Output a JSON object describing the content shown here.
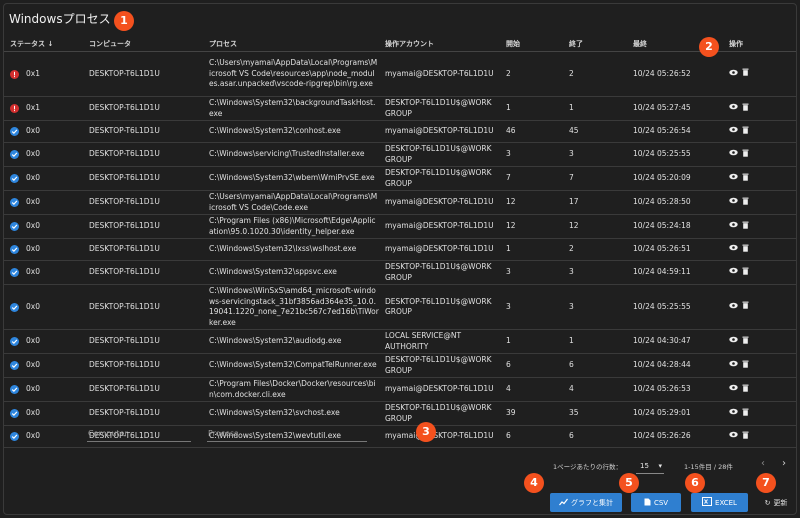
{
  "title": "Windowsプロセス",
  "columns": {
    "status": "ステータス",
    "computer": "コンピュータ",
    "process": "プロセス",
    "account": "操作アカウント",
    "start": "開始",
    "end": "終了",
    "latest": "最終",
    "ops": "操作"
  },
  "rows": [
    {
      "status": "err",
      "code": "0x1",
      "computer": "DESKTOP-T6L1D1U",
      "process": "C:\\Users\\myamai\\AppData\\Local\\Programs\\Microsoft VS Code\\resources\\app\\node_modules.asar.unpacked\\vscode-ripgrep\\bin\\rg.exe",
      "account": "myamai@DESKTOP-T6L1D1U",
      "start": "2",
      "end": "2",
      "latest": "10/24 05:26:52",
      "h": "h4"
    },
    {
      "status": "err",
      "code": "0x1",
      "computer": "DESKTOP-T6L1D1U",
      "process": "C:\\Windows\\System32\\backgroundTaskHost.exe",
      "account": "DESKTOP-T6L1D1U$@WORK GROUP",
      "start": "1",
      "end": "1",
      "latest": "10/24 05:27:45",
      "h": "h2"
    },
    {
      "status": "ok",
      "code": "0x0",
      "computer": "DESKTOP-T6L1D1U",
      "process": "C:\\Windows\\System32\\conhost.exe",
      "account": "myamai@DESKTOP-T6L1D1U",
      "start": "46",
      "end": "45",
      "latest": "10/24 05:26:54",
      "h": "r"
    },
    {
      "status": "ok",
      "code": "0x0",
      "computer": "DESKTOP-T6L1D1U",
      "process": "C:\\Windows\\servicing\\TrustedInstaller.exe",
      "account": "DESKTOP-T6L1D1U$@WORK GROUP",
      "start": "3",
      "end": "3",
      "latest": "10/24 05:25:55",
      "h": "h2"
    },
    {
      "status": "ok",
      "code": "0x0",
      "computer": "DESKTOP-T6L1D1U",
      "process": "C:\\Windows\\System32\\wbem\\WmiPrvSE.exe",
      "account": "DESKTOP-T6L1D1U$@WORK GROUP",
      "start": "7",
      "end": "7",
      "latest": "10/24 05:20:09",
      "h": "h2"
    },
    {
      "status": "ok",
      "code": "0x0",
      "computer": "DESKTOP-T6L1D1U",
      "process": "C:\\Users\\myamai\\AppData\\Local\\Programs\\Microsoft VS Code\\Code.exe",
      "account": "myamai@DESKTOP-T6L1D1U",
      "start": "12",
      "end": "17",
      "latest": "10/24 05:28:50",
      "h": "h2"
    },
    {
      "status": "ok",
      "code": "0x0",
      "computer": "DESKTOP-T6L1D1U",
      "process": "C:\\Program Files (x86)\\Microsoft\\Edge\\Application\\95.0.1020.30\\identity_helper.exe",
      "account": "myamai@DESKTOP-T6L1D1U",
      "start": "12",
      "end": "12",
      "latest": "10/24 05:24:18",
      "h": "h2"
    },
    {
      "status": "ok",
      "code": "0x0",
      "computer": "DESKTOP-T6L1D1U",
      "process": "C:\\Windows\\System32\\lxss\\wslhost.exe",
      "account": "myamai@DESKTOP-T6L1D1U",
      "start": "1",
      "end": "2",
      "latest": "10/24 05:26:51",
      "h": "r"
    },
    {
      "status": "ok",
      "code": "0x0",
      "computer": "DESKTOP-T6L1D1U",
      "process": "C:\\Windows\\System32\\sppsvc.exe",
      "account": "DESKTOP-T6L1D1U$@WORK GROUP",
      "start": "3",
      "end": "3",
      "latest": "10/24 04:59:11",
      "h": "h2"
    },
    {
      "status": "ok",
      "code": "0x0",
      "computer": "DESKTOP-T6L1D1U",
      "process": "C:\\Windows\\WinSxS\\amd64_microsoft-windows-servicingstack_31bf3856ad364e35_10.0.19041.1220_none_7e21bc567c7ed16b\\TiWorker.exe",
      "account": "DESKTOP-T6L1D1U$@WORK GROUP",
      "start": "3",
      "end": "3",
      "latest": "10/24 05:25:55",
      "h": "h4"
    },
    {
      "status": "ok",
      "code": "0x0",
      "computer": "DESKTOP-T6L1D1U",
      "process": "C:\\Windows\\System32\\audiodg.exe",
      "account": "LOCAL SERVICE@NT AUTHORITY",
      "start": "1",
      "end": "1",
      "latest": "10/24 04:30:47",
      "h": "h2"
    },
    {
      "status": "ok",
      "code": "0x0",
      "computer": "DESKTOP-T6L1D1U",
      "process": "C:\\Windows\\System32\\CompatTelRunner.exe",
      "account": "DESKTOP-T6L1D1U$@WORK GROUP",
      "start": "6",
      "end": "6",
      "latest": "10/24 04:28:44",
      "h": "h2"
    },
    {
      "status": "ok",
      "code": "0x0",
      "computer": "DESKTOP-T6L1D1U",
      "process": "C:\\Program Files\\Docker\\Docker\\resources\\bin\\com.docker.cli.exe",
      "account": "myamai@DESKTOP-T6L1D1U",
      "start": "4",
      "end": "4",
      "latest": "10/24 05:26:53",
      "h": "h2"
    },
    {
      "status": "ok",
      "code": "0x0",
      "computer": "DESKTOP-T6L1D1U",
      "process": "C:\\Windows\\System32\\svchost.exe",
      "account": "DESKTOP-T6L1D1U$@WORK GROUP",
      "start": "39",
      "end": "35",
      "latest": "10/24 05:29:01",
      "h": "h2"
    },
    {
      "status": "ok",
      "code": "0x0",
      "computer": "DESKTOP-T6L1D1U",
      "process": "C:\\Windows\\System32\\wevtutil.exe",
      "account": "myamai@DESKTOP-T6L1D1U",
      "start": "6",
      "end": "6",
      "latest": "10/24 05:26:26",
      "h": "r"
    }
  ],
  "filters": {
    "computer": "Computer",
    "process": "Process"
  },
  "pager": {
    "rows_per_page_label": "1ページあたりの行数：",
    "rows_per_page": "15",
    "range": "1-15件目 / 28件"
  },
  "buttons": {
    "graph": "グラフと集計",
    "csv": "CSV",
    "excel": "EXCEL",
    "refresh": "更新"
  },
  "badges": [
    "1",
    "2",
    "3",
    "4",
    "5",
    "6",
    "7"
  ],
  "colors": {
    "accent": "#2f7fd0",
    "error": "#d32f2f",
    "ok": "#2e86de",
    "badge": "#f4511e"
  }
}
